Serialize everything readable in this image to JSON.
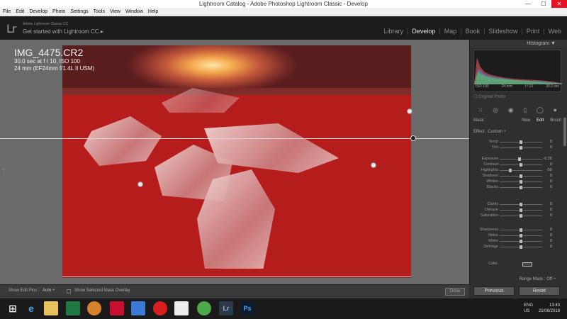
{
  "window": {
    "title": "Lightroom Catalog - Adobe Photoshop Lightroom Classic - Develop",
    "minimize": "—",
    "maximize": "☐",
    "close": "✕"
  },
  "menu": [
    "File",
    "Edit",
    "Develop",
    "Photo",
    "Settings",
    "Tools",
    "View",
    "Window",
    "Help"
  ],
  "identity": {
    "logo": "Lr",
    "product": "Adobe Lightroom Classic CC",
    "tagline": "Get started with Lightroom CC  ▸"
  },
  "modules": [
    "Library",
    "Develop",
    "Map",
    "Book",
    "Slideshow",
    "Print",
    "Web"
  ],
  "active_module": "Develop",
  "photo_info": {
    "filename": "IMG_4475.CR2",
    "exposure": "30.0 sec at f / 10, ISO 100",
    "lens": "24 mm (EF24mm f/1.4L II USM)"
  },
  "panel": {
    "header": "Histogram ▼",
    "histogram_readout": [
      "ISO 100",
      "24 mm",
      "f / 10",
      "30.0 sec"
    ],
    "original_photo": "☐ Original Photo",
    "tools": [
      "⁙",
      "◎",
      "◉",
      "▯",
      "◯",
      "●"
    ],
    "mask": {
      "label": "Mask :",
      "new": "New",
      "edit": "Edit",
      "brush": "Brush"
    },
    "effect": "Effect :   Custom ÷",
    "sliders": [
      {
        "label": "Temp",
        "value": "0",
        "pos": 0.5
      },
      {
        "label": "Tint",
        "value": "0",
        "pos": 0.5
      },
      {
        "label": "Exposure",
        "value": "-0.26",
        "pos": 0.46
      },
      {
        "label": "Contrast",
        "value": "0",
        "pos": 0.5
      },
      {
        "label": "Highlights",
        "value": "-50",
        "pos": 0.25
      },
      {
        "label": "Shadows",
        "value": "0",
        "pos": 0.5
      },
      {
        "label": "Whites",
        "value": "0",
        "pos": 0.5
      },
      {
        "label": "Blacks",
        "value": "0",
        "pos": 0.5
      },
      {
        "label": "Clarity",
        "value": "0",
        "pos": 0.5
      },
      {
        "label": "Dehaze",
        "value": "0",
        "pos": 0.5
      },
      {
        "label": "Saturation",
        "value": "0",
        "pos": 0.5
      },
      {
        "label": "Sharpness",
        "value": "0",
        "pos": 0.5
      },
      {
        "label": "Noise",
        "value": "0",
        "pos": 0.5
      },
      {
        "label": "Moire",
        "value": "0",
        "pos": 0.5
      },
      {
        "label": "Defringe",
        "value": "0",
        "pos": 0.5
      }
    ],
    "color_label": "Color",
    "range_mask": "Range Mask : Off ÷",
    "previous": "Previous",
    "reset": "Reset"
  },
  "bottombar": {
    "show_edit_pins": "Show Edit Pins :",
    "auto": "Auto ÷",
    "overlay": "Show Selected Mask Overlay",
    "done": "Done"
  },
  "taskbar": {
    "start": "⊞",
    "lang": [
      "ENG",
      "US"
    ],
    "time": "13:40",
    "date": "21/08/2018"
  }
}
